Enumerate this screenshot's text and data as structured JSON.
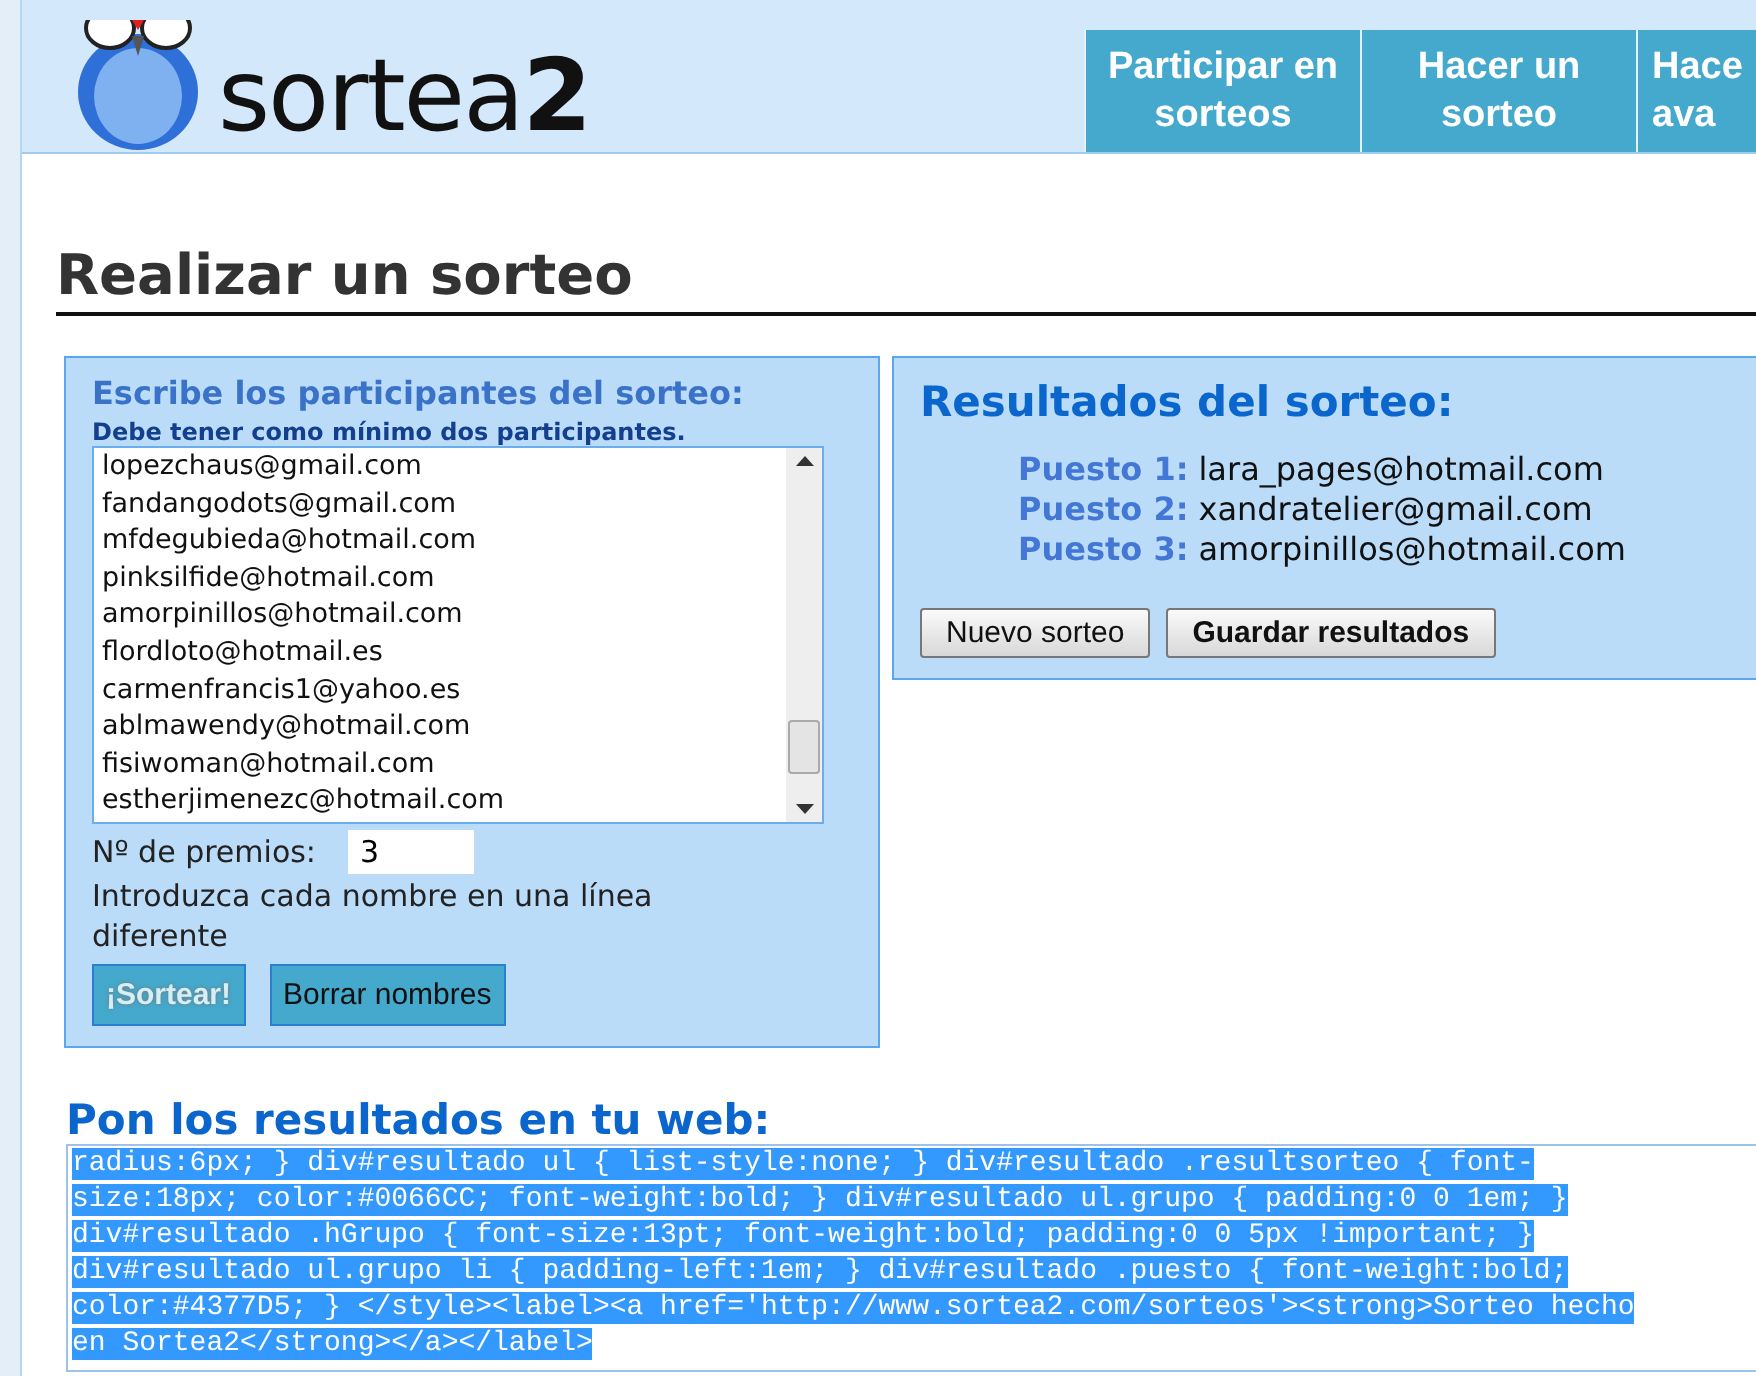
{
  "header": {
    "logo": "sortea**2**",
    "nav": [
      {
        "lines": [
          "Participar en",
          "sorteos"
        ]
      },
      {
        "lines": [
          "Hacer un",
          "sorteo"
        ]
      },
      {
        "lines": [
          "Hace",
          "ava"
        ]
      }
    ]
  },
  "page_title": "Realizar un sorteo",
  "participants_panel": {
    "title": "Escribe los participantes del sorteo:",
    "note": "Debe tener como mínimo dos participantes.",
    "entries": [
      "lopezchaus@gmail.com",
      "fandangodots@gmail.com",
      "mfdegubieda@hotmail.com",
      "pinksilfide@hotmail.com",
      "amorpinillos@hotmail.com",
      "flordloto@hotmail.es",
      "carmenfrancis1@yahoo.es",
      "ablmawendy@hotmail.com",
      "fisiwoman@hotmail.com",
      "estherjimenezc@hotmail.com"
    ],
    "prizes_label": "Nº de premios:",
    "prizes_value": "3",
    "hint": "Introduzca cada nombre en una línea diferente",
    "buttons": [
      {
        "label": "¡Sortear!",
        "disabled": true
      },
      {
        "label": "Borrar nombres",
        "disabled": false
      }
    ]
  },
  "results_panel": {
    "title": "Resultados del sorteo:",
    "results": [
      {
        "place": "Puesto 1:",
        "winner": "lara_pages@hotmail.com"
      },
      {
        "place": "Puesto 2:",
        "winner": "xandratelier@gmail.com"
      },
      {
        "place": "Puesto 3:",
        "winner": "amorpinillos@hotmail.com"
      }
    ],
    "buttons": [
      {
        "label": "Nuevo sorteo",
        "bold": false
      },
      {
        "label": "Guardar resultados",
        "bold": true
      }
    ]
  },
  "embed": {
    "title": "Pon los resultados en tu web:",
    "code_lines": [
      "radius:6px; } div#resultado ul { list-style:none; } div#resultado .resultsorteo { font-",
      "size:18px; color:#0066CC; font-weight:bold; } div#resultado ul.grupo { padding:0 0 1em; }",
      "div#resultado .hGrupo { font-size:13pt; font-weight:bold; padding:0 0 5px !important; }",
      "div#resultado ul.grupo li { padding-left:1em; } div#resultado .puesto { font-weight:bold;",
      "color:#4377D5; } </style><label><a href='http://www.sortea2.com/sorteos'><strong>Sorteo hecho",
      "en Sortea2</strong></a></label>"
    ]
  }
}
